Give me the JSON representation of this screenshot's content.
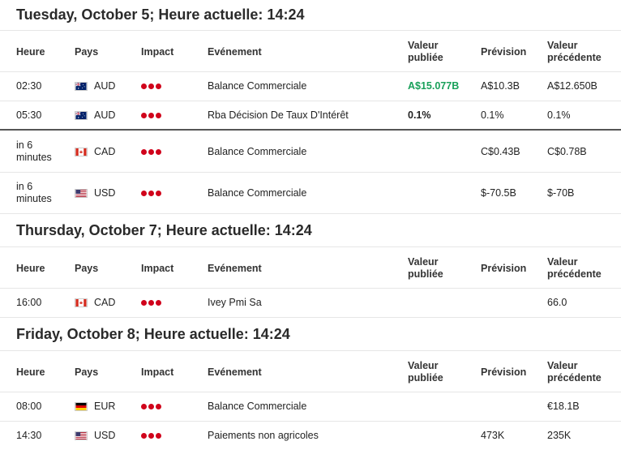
{
  "columns": {
    "time": "Heure",
    "country": "Pays",
    "impact": "Impact",
    "event": "Evénement",
    "actual_1": "Valeur",
    "actual_2": "publiée",
    "forecast": "Prévision",
    "previous_1": "Valeur",
    "previous_2": "précédente"
  },
  "days": [
    {
      "title": "Tuesday, October 5; Heure actuelle: 14:24",
      "rows": [
        {
          "time": "02:30",
          "country": "AUD",
          "flag": "australia-flag-icon",
          "impact": 3,
          "event": "Balance Commerciale",
          "actual": "A$15.077B",
          "forecast": "A$10.3B",
          "previous": "A$12.650B"
        },
        {
          "time": "05:30",
          "country": "AUD",
          "flag": "australia-flag-icon",
          "impact": 3,
          "event": "Rba Décision De Taux D'Intérêt",
          "actual": "0.1%",
          "forecast": "0.1%",
          "previous": "0.1%"
        },
        {
          "time_1": "in 6",
          "time_2": "minutes",
          "country": "CAD",
          "flag": "canada-flag-icon",
          "impact": 3,
          "event": "Balance Commerciale",
          "actual": "",
          "forecast": "C$0.43B",
          "previous": "C$0.78B"
        },
        {
          "time_1": "in 6",
          "time_2": "minutes",
          "country": "USD",
          "flag": "usa-flag-icon",
          "impact": 3,
          "event": "Balance Commerciale",
          "actual": "",
          "forecast": "$-70.5B",
          "previous": "$-70B"
        }
      ]
    },
    {
      "title": "Thursday, October 7; Heure actuelle: 14:24",
      "rows": [
        {
          "time": "16:00",
          "country": "CAD",
          "flag": "canada-flag-icon",
          "impact": 3,
          "event": "Ivey Pmi Sa",
          "actual": "",
          "forecast": "",
          "previous": "66.0"
        }
      ]
    },
    {
      "title": "Friday, October 8; Heure actuelle: 14:24",
      "rows": [
        {
          "time": "08:00",
          "country": "EUR",
          "flag": "germany-flag-icon",
          "impact": 3,
          "event": "Balance Commerciale",
          "actual": "",
          "forecast": "",
          "previous": "€18.1B"
        },
        {
          "time": "14:30",
          "country": "USD",
          "flag": "usa-flag-icon",
          "impact": 3,
          "event": "Paiements non agricoles",
          "actual": "",
          "forecast": "473K",
          "previous": "235K"
        }
      ]
    }
  ],
  "colors": {
    "impact_dot": "#d0021b",
    "actual_positive": "#19a05a"
  }
}
